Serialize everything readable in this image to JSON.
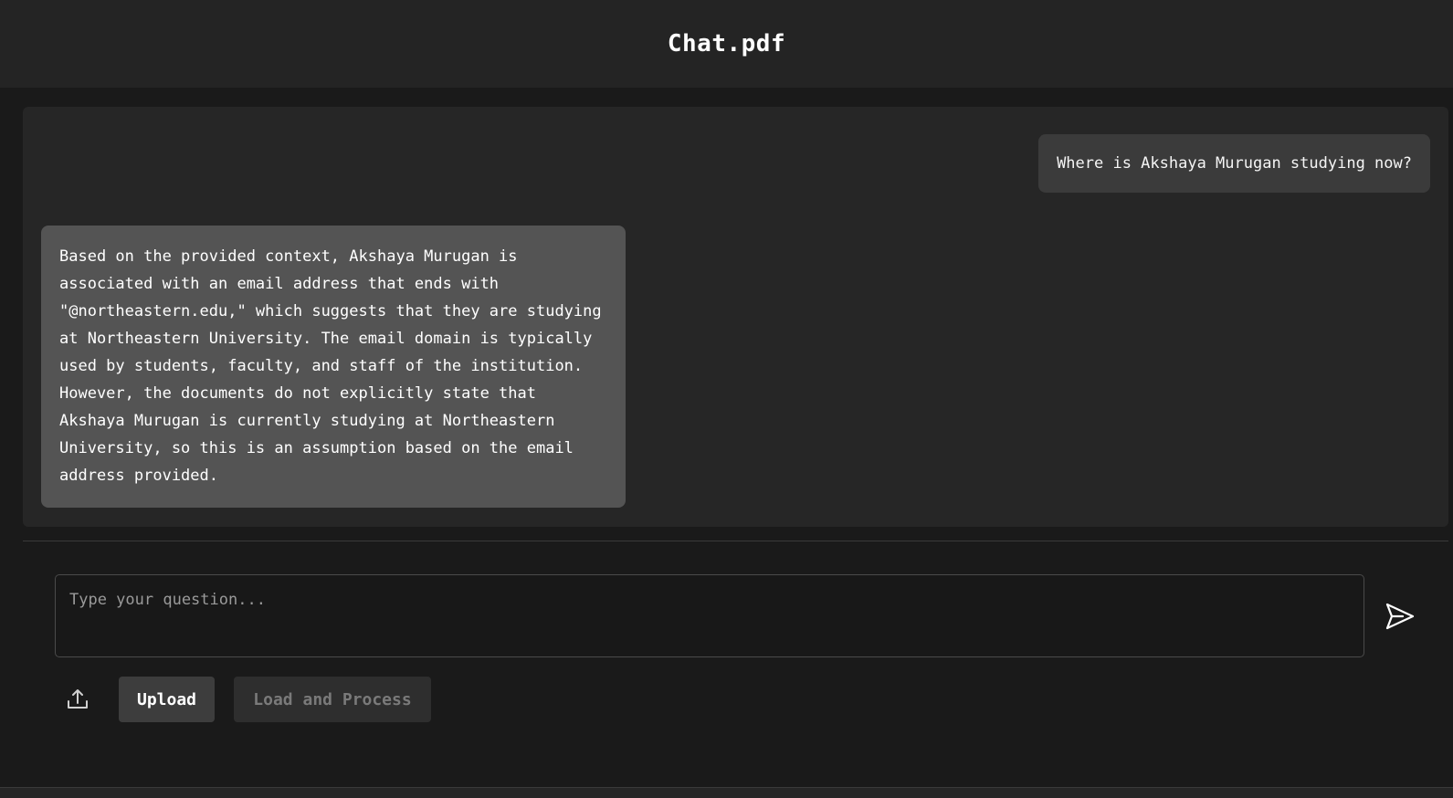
{
  "header": {
    "title": "Chat.pdf"
  },
  "chat": {
    "messages": [
      {
        "role": "user",
        "text": "Where is Akshaya Murugan studying now?"
      },
      {
        "role": "assistant",
        "text": "Based on the provided context, Akshaya Murugan is associated with an email address that ends with \"@northeastern.edu,\" which suggests that they are studying at Northeastern University. The email domain is typically used by students, faculty, and staff of the institution. However, the documents do not explicitly state that Akshaya Murugan is currently studying at Northeastern University, so this is an assumption based on the email address provided."
      }
    ]
  },
  "composer": {
    "placeholder": "Type your question...",
    "value": "",
    "send_icon": "send-icon"
  },
  "toolbar": {
    "upload_icon": "upload-icon",
    "upload_label": "Upload",
    "load_label": "Load and Process"
  },
  "colors": {
    "background": "#1a1a1a",
    "header": "#242424",
    "panel": "#262626",
    "user_bubble": "#3b3b3b",
    "assistant_bubble": "#545454"
  }
}
